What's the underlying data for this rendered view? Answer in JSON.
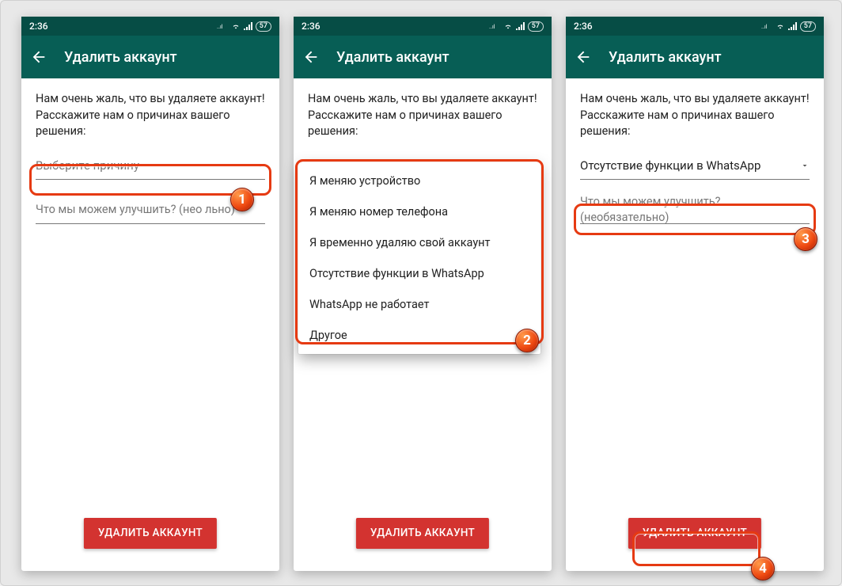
{
  "status": {
    "time": "2:36",
    "battery": "57"
  },
  "appbar": {
    "title": "Удалить аккаунт"
  },
  "intro": "Нам очень жаль, что вы удаляете аккаунт! Расскажите нам о причинах вашего решения:",
  "placeholder": {
    "reason": "Выберите причину",
    "improve": "Что мы можем улучшить? (необязательно)"
  },
  "selected_reason": "Отсутствие функции в WhatsApp",
  "improve_truncated": "Что мы можем улучшить? (нео            льно)",
  "dropdown": [
    "Я меняю устройство",
    "Я меняю номер телефона",
    "Я временно удаляю свой аккаунт",
    "Отсутствие функции в WhatsApp",
    "WhatsApp не работает",
    "Другое"
  ],
  "delete_button": "УДАЛИТЬ АККАУНТ",
  "badges": {
    "b1": "1",
    "b2": "2",
    "b3": "3",
    "b4": "4"
  }
}
